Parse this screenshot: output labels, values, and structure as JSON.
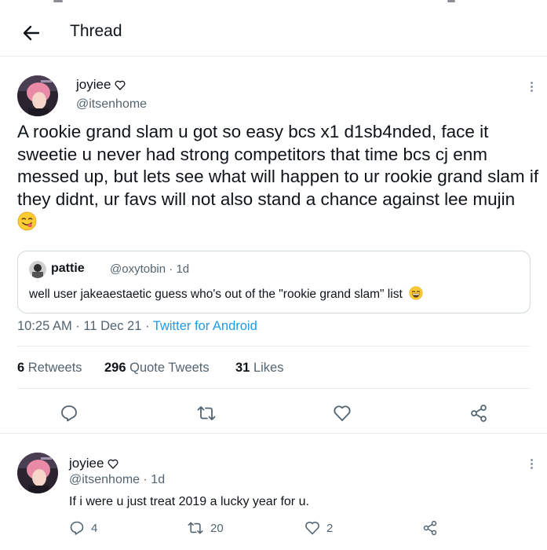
{
  "header": {
    "title": "Thread"
  },
  "main_tweet": {
    "author_name": "joyiee",
    "author_handle": "@itsenhome",
    "text": "A rookie grand slam u got so easy bcs x1 d1sb4nded, face it sweetie u never had strong competitors that time bcs cj enm messed up, but lets see what will happen to ur rookie grand slam if they didnt, ur favs will not also stand a chance against lee mujin",
    "text_emoji": "face-savoring-food-emoji",
    "quote": {
      "author_name": "pattie",
      "author_handle": "@oxytobin",
      "age": "1d",
      "text": "well user jakeaestaetic guess who's out of the \"rookie grand slam\" list",
      "emoji": "grinning-face-emoji"
    },
    "time": "10:25 AM",
    "date": "11 Dec 21",
    "source": "Twitter for Android",
    "retweets_count": "6",
    "retweets_label": "Retweets",
    "quotes_count": "296",
    "quotes_label": "Quote Tweets",
    "likes_count": "31",
    "likes_label": "Likes"
  },
  "reply_tweet": {
    "author_name": "joyiee",
    "author_handle": "@itsenhome",
    "age": "1d",
    "text": "If i were u just treat 2019 a lucky year for u.",
    "replies_count": "4",
    "retweets_count": "20",
    "likes_count": "2"
  },
  "icons": {
    "back": "back-arrow-icon",
    "more": "more-vertical-icon",
    "reply": "reply-icon",
    "retweet": "retweet-icon",
    "like": "heart-icon",
    "share": "share-icon",
    "verified_like": "heart-outline-icon"
  },
  "colors": {
    "text_primary": "#0f1419",
    "text_secondary": "#536471",
    "link": "#1d9bf0",
    "divider": "#e6ecf0",
    "border": "#cfd9de"
  }
}
